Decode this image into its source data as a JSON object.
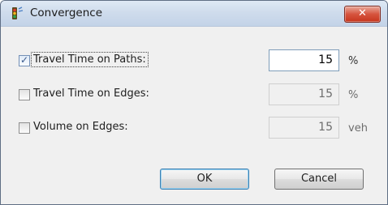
{
  "window": {
    "title": "Convergence",
    "close_glyph": "✕"
  },
  "rows": [
    {
      "label": "Travel Time on Paths:",
      "checked": true,
      "value": "15",
      "unit": "%",
      "enabled": true
    },
    {
      "label": "Travel Time on Edges:",
      "checked": false,
      "value": "15",
      "unit": "%",
      "enabled": false
    },
    {
      "label": "Volume on Edges:",
      "checked": false,
      "value": "15",
      "unit": "veh",
      "enabled": false
    }
  ],
  "buttons": {
    "ok_label": "OK",
    "cancel_label": "Cancel"
  },
  "icons": {
    "app": "traffic-light-icon",
    "close": "close-icon",
    "check": "checkmark-icon"
  },
  "colors": {
    "close_button": "#c7351d",
    "default_button_border": "#3c7fb1"
  }
}
